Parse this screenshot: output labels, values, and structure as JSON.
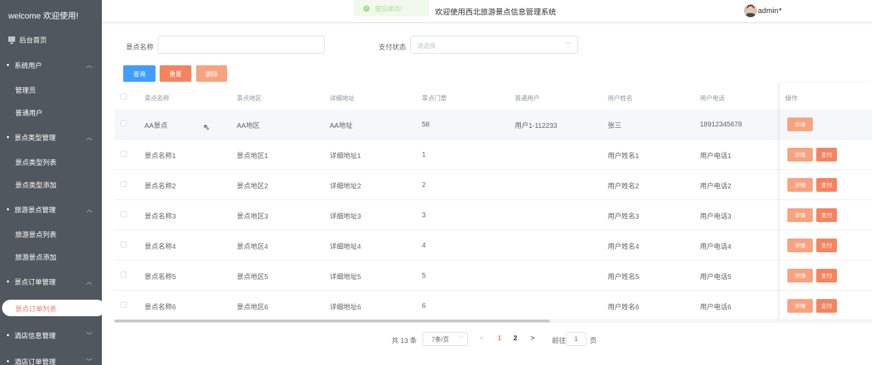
{
  "sidebar": {
    "welcome": "welcome 欢迎使用!",
    "home": "后台首页",
    "groups": [
      {
        "label": "系统用户",
        "chevron": "^",
        "items": [
          "管理员",
          "普通用户"
        ]
      },
      {
        "label": "景点类型管理",
        "chevron": "^",
        "items": [
          "景点类型列表",
          "景点类型添加"
        ]
      },
      {
        "label": "旅游景点管理",
        "chevron": "^",
        "items": [
          "旅游景点列表",
          "旅游景点添加"
        ]
      },
      {
        "label": "景点订单管理",
        "chevron": "^",
        "items": [
          "景点订单列表"
        ]
      },
      {
        "label": "酒店信息管理",
        "chevron": "v",
        "items": []
      },
      {
        "label": "酒店订单管理",
        "chevron": "v",
        "items": []
      }
    ]
  },
  "header": {
    "toast": "提交成功!",
    "title": "欢迎使用西北旅游景点信息管理系统",
    "user": "admin",
    "caret": "▾"
  },
  "search": {
    "name_label": "景点名称",
    "name_value": "",
    "pay_label": "支付状态",
    "pay_placeholder": "请选择",
    "query": "查询",
    "reset": "重置",
    "delete": "删除"
  },
  "table": {
    "columns": [
      "景点名称",
      "景点地区",
      "详细地址",
      "景点门票",
      "普通用户",
      "用户姓名",
      "用户电话",
      "操作"
    ],
    "rows": [
      [
        "AA景点",
        "AA地区",
        "AA地址",
        "58",
        "用户1-112233",
        "张三",
        "18912345678"
      ],
      [
        "景点名称1",
        "景点地区1",
        "详细地址1",
        "1",
        "",
        "用户姓名1",
        "用户电话1"
      ],
      [
        "景点名称2",
        "景点地区2",
        "详细地址2",
        "2",
        "",
        "用户姓名2",
        "用户电话2"
      ],
      [
        "景点名称3",
        "景点地区3",
        "详细地址3",
        "3",
        "",
        "用户姓名3",
        "用户电话3"
      ],
      [
        "景点名称4",
        "景点地区4",
        "详细地址4",
        "4",
        "",
        "用户姓名4",
        "用户电话4"
      ],
      [
        "景点名称5",
        "景点地区5",
        "详细地址5",
        "5",
        "",
        "用户姓名5",
        "用户电话5"
      ],
      [
        "景点名称6",
        "景点地区6",
        "详细地址6",
        "6",
        "",
        "用户姓名6",
        "用户电话6"
      ]
    ],
    "detail": "详情",
    "pay": "支付"
  },
  "pagination": {
    "total": "共 13 条",
    "page_size": "7条/页",
    "prev": "<",
    "pages": [
      "1",
      "2"
    ],
    "next": ">",
    "goto": "前往",
    "goto_value": "1",
    "page_unit": "页"
  },
  "colors": {
    "sidebar": "#50575e",
    "primary": "#409eff",
    "reset": "#f4845f",
    "delete": "#f9a27f",
    "active_page": "#f4845f"
  }
}
